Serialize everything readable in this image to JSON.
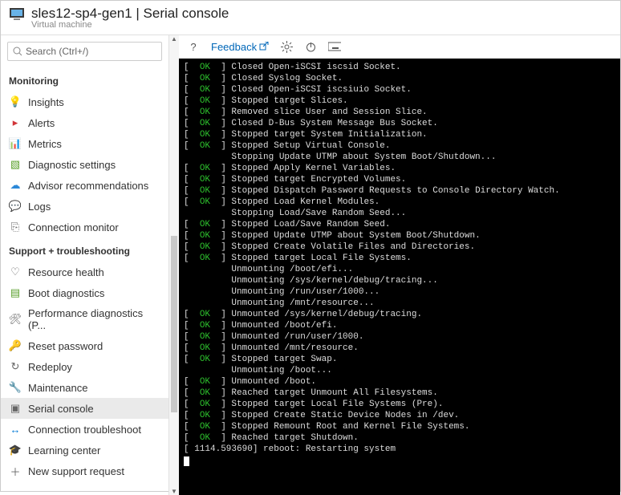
{
  "header": {
    "title": "sles12-sp4-gen1 | Serial console",
    "subtitle": "Virtual machine"
  },
  "search": {
    "placeholder": "Search (Ctrl+/)"
  },
  "sections": {
    "monitoring": {
      "label": "Monitoring",
      "items": [
        {
          "icon": "💡",
          "color": "#8a5cd6",
          "label": "Insights"
        },
        {
          "icon": "▸",
          "color": "#d13438",
          "label": "Alerts"
        },
        {
          "icon": "📊",
          "color": "#0078d4",
          "label": "Metrics"
        },
        {
          "icon": "▧",
          "color": "#5aa02c",
          "label": "Diagnostic settings"
        },
        {
          "icon": "☁",
          "color": "#2b88d8",
          "label": "Advisor recommendations"
        },
        {
          "icon": "💬",
          "color": "#8a5cd6",
          "label": "Logs"
        },
        {
          "icon": "⎘",
          "color": "#666",
          "label": "Connection monitor"
        }
      ]
    },
    "support": {
      "label": "Support + troubleshooting",
      "items": [
        {
          "icon": "♡",
          "color": "#666",
          "label": "Resource health"
        },
        {
          "icon": "▤",
          "color": "#5aa02c",
          "label": "Boot diagnostics"
        },
        {
          "icon": "🛠",
          "color": "#666",
          "label": "Performance diagnostics (P..."
        },
        {
          "icon": "🔑",
          "color": "#e3b505",
          "label": "Reset password"
        },
        {
          "icon": "↻",
          "color": "#666",
          "label": "Redeploy"
        },
        {
          "icon": "🔧",
          "color": "#666",
          "label": "Maintenance"
        },
        {
          "icon": "▣",
          "color": "#666",
          "label": "Serial console",
          "active": true
        },
        {
          "icon": "↔",
          "color": "#0078d4",
          "label": "Connection troubleshoot"
        },
        {
          "icon": "🎓",
          "color": "#666",
          "label": "Learning center"
        },
        {
          "icon": "＋",
          "color": "#666",
          "label": "New support request"
        }
      ]
    }
  },
  "toolbar": {
    "help": "?",
    "feedback": "Feedback"
  },
  "console_lines": [
    {
      "status": "OK",
      "msg": "Closed Open-iSCSI iscsid Socket."
    },
    {
      "status": "OK",
      "msg": "Closed Syslog Socket."
    },
    {
      "status": "OK",
      "msg": "Closed Open-iSCSI iscsiuio Socket."
    },
    {
      "status": "OK",
      "msg": "Stopped target Slices."
    },
    {
      "status": "OK",
      "msg": "Removed slice User and Session Slice."
    },
    {
      "status": "OK",
      "msg": "Closed D-Bus System Message Bus Socket."
    },
    {
      "status": "OK",
      "msg": "Stopped target System Initialization."
    },
    {
      "status": "OK",
      "msg": "Stopped Setup Virtual Console."
    },
    {
      "status": "",
      "msg": "Stopping Update UTMP about System Boot/Shutdown..."
    },
    {
      "status": "OK",
      "msg": "Stopped Apply Kernel Variables."
    },
    {
      "status": "OK",
      "msg": "Stopped target Encrypted Volumes."
    },
    {
      "status": "OK",
      "msg": "Stopped Dispatch Password Requests to Console Directory Watch."
    },
    {
      "status": "OK",
      "msg": "Stopped Load Kernel Modules."
    },
    {
      "status": "",
      "msg": "Stopping Load/Save Random Seed..."
    },
    {
      "status": "OK",
      "msg": "Stopped Load/Save Random Seed."
    },
    {
      "status": "OK",
      "msg": "Stopped Update UTMP about System Boot/Shutdown."
    },
    {
      "status": "OK",
      "msg": "Stopped Create Volatile Files and Directories."
    },
    {
      "status": "OK",
      "msg": "Stopped target Local File Systems."
    },
    {
      "status": "",
      "msg": "Unmounting /boot/efi..."
    },
    {
      "status": "",
      "msg": "Unmounting /sys/kernel/debug/tracing..."
    },
    {
      "status": "",
      "msg": "Unmounting /run/user/1000..."
    },
    {
      "status": "",
      "msg": "Unmounting /mnt/resource..."
    },
    {
      "status": "OK",
      "msg": "Unmounted /sys/kernel/debug/tracing."
    },
    {
      "status": "OK",
      "msg": "Unmounted /boot/efi."
    },
    {
      "status": "OK",
      "msg": "Unmounted /run/user/1000."
    },
    {
      "status": "OK",
      "msg": "Unmounted /mnt/resource."
    },
    {
      "status": "OK",
      "msg": "Stopped target Swap."
    },
    {
      "status": "",
      "msg": "Unmounting /boot..."
    },
    {
      "status": "OK",
      "msg": "Unmounted /boot."
    },
    {
      "status": "OK",
      "msg": "Reached target Unmount All Filesystems."
    },
    {
      "status": "OK",
      "msg": "Stopped target Local File Systems (Pre)."
    },
    {
      "status": "OK",
      "msg": "Stopped Create Static Device Nodes in /dev."
    },
    {
      "status": "OK",
      "msg": "Stopped Remount Root and Kernel File Systems."
    },
    {
      "status": "OK",
      "msg": "Reached target Shutdown."
    }
  ],
  "console_final": "[ 1114.593690] reboot: Restarting system"
}
